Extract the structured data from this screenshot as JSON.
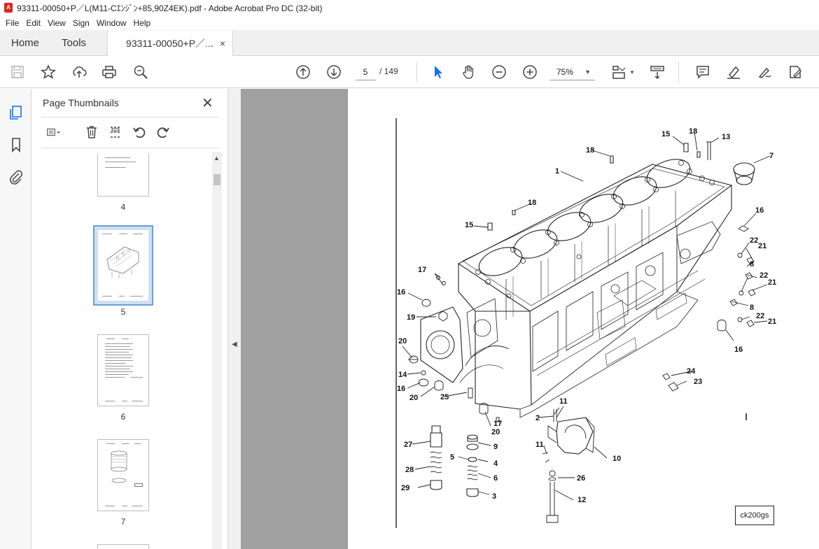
{
  "window": {
    "title": "93311-00050+P／L(M11-Cｴﾝｼﾞﾝ+85,90Z4EK).pdf - Adobe Acrobat Pro DC (32-bit)"
  },
  "menu": [
    "File",
    "Edit",
    "View",
    "Sign",
    "Window",
    "Help"
  ],
  "tabs": {
    "home": "Home",
    "tools": "Tools",
    "document": "93311-00050+P／...",
    "close": "×"
  },
  "toolbar": {
    "current_page": "5",
    "page_total": "/  149",
    "zoom": "75%",
    "icons": [
      "save-icon",
      "star-icon",
      "upload-icon",
      "print-icon",
      "zoom-search-icon",
      "page-up-icon",
      "page-down-icon",
      "select-arrow-icon",
      "hand-icon",
      "zoom-out-icon",
      "zoom-in-icon",
      "page-fit-icon",
      "scroll-mode-icon",
      "comment-icon",
      "highlight-icon",
      "sign-icon",
      "edit-pdf-icon"
    ]
  },
  "thumbnails_panel": {
    "title": "Page Thumbnails",
    "close": "✕",
    "pages": [
      {
        "number": "4"
      },
      {
        "number": "5",
        "selected": true
      },
      {
        "number": "6"
      },
      {
        "number": "7"
      }
    ]
  },
  "document": {
    "stamp": "ck200gs",
    "callouts": [
      "1",
      "2",
      "3",
      "4",
      "5",
      "6",
      "7",
      "8",
      "8",
      "9",
      "10",
      "11",
      "11",
      "12",
      "13",
      "14",
      "15",
      "15",
      "16",
      "16",
      "16",
      "16",
      "17",
      "17",
      "18",
      "18",
      "18",
      "19",
      "20",
      "20",
      "20",
      "21",
      "21",
      "21",
      "22",
      "22",
      "22",
      "23",
      "24",
      "25",
      "26",
      "27",
      "28",
      "29"
    ]
  },
  "colors": {
    "accent": "#1473e6",
    "select_blue": "#6a9fd6",
    "pdf_red": "#d9281e"
  }
}
